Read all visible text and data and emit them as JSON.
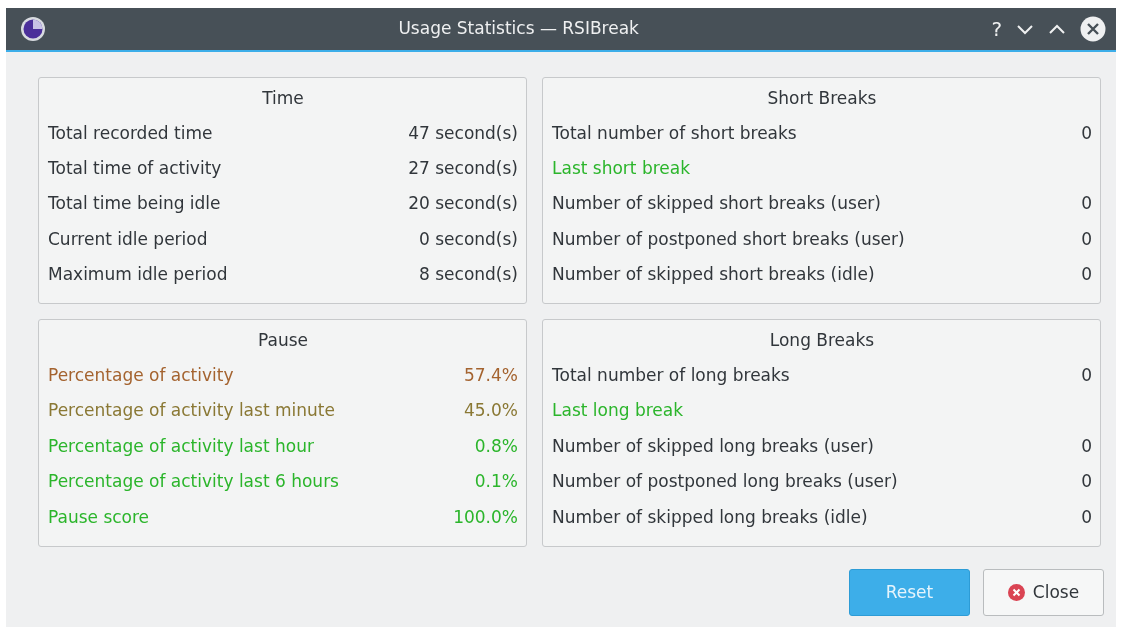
{
  "window": {
    "title": "Usage Statistics — RSIBreak",
    "controls": [
      "?"
    ]
  },
  "groups": [
    {
      "title": "Time",
      "rows": [
        {
          "label": "Total recorded time",
          "value": "47 second(s)"
        },
        {
          "label": "Total time of activity",
          "value": "27 second(s)"
        },
        {
          "label": "Total time being idle",
          "value": "20 second(s)"
        },
        {
          "label": "Current idle period",
          "value": "0 second(s)"
        },
        {
          "label": "Maximum idle period",
          "value": "8 second(s)"
        }
      ]
    },
    {
      "title": "Short Breaks",
      "rows": [
        {
          "label": "Total number of short breaks",
          "value": "0"
        },
        {
          "label": "Last short break",
          "color": "#2bb52b"
        },
        {
          "label": "Number of skipped short breaks (user)",
          "value": "0"
        },
        {
          "label": "Number of postponed short breaks (user)",
          "value": "0"
        },
        {
          "label": "Number of skipped short breaks (idle)",
          "value": "0"
        }
      ]
    },
    {
      "title": "Pause",
      "rows": [
        {
          "label": "Percentage of activity",
          "value": "57.4%",
          "color": "#a4632f"
        },
        {
          "label": "Percentage of activity last minute",
          "value": "45.0%",
          "color": "#8a7834"
        },
        {
          "label": "Percentage of activity last hour",
          "value": "0.8%",
          "color": "#2bb52b"
        },
        {
          "label": "Percentage of activity last 6 hours",
          "value": "0.1%",
          "color": "#2bb52b"
        },
        {
          "label": "Pause score",
          "value": "100.0%",
          "color": "#2bb52b"
        }
      ]
    },
    {
      "title": "Long Breaks",
      "rows": [
        {
          "label": "Total number of long breaks",
          "value": "0"
        },
        {
          "label": "Last long break",
          "color": "#2bb52b"
        },
        {
          "label": "Number of skipped long breaks (user)",
          "value": "0"
        },
        {
          "label": "Number of postponed long breaks (user)",
          "value": "0"
        },
        {
          "label": "Number of skipped long breaks (idle)",
          "value": "0"
        }
      ]
    }
  ],
  "buttons": [
    {
      "label": "Reset",
      "kind": "primary"
    },
    {
      "label": "Close",
      "kind": "close"
    }
  ]
}
